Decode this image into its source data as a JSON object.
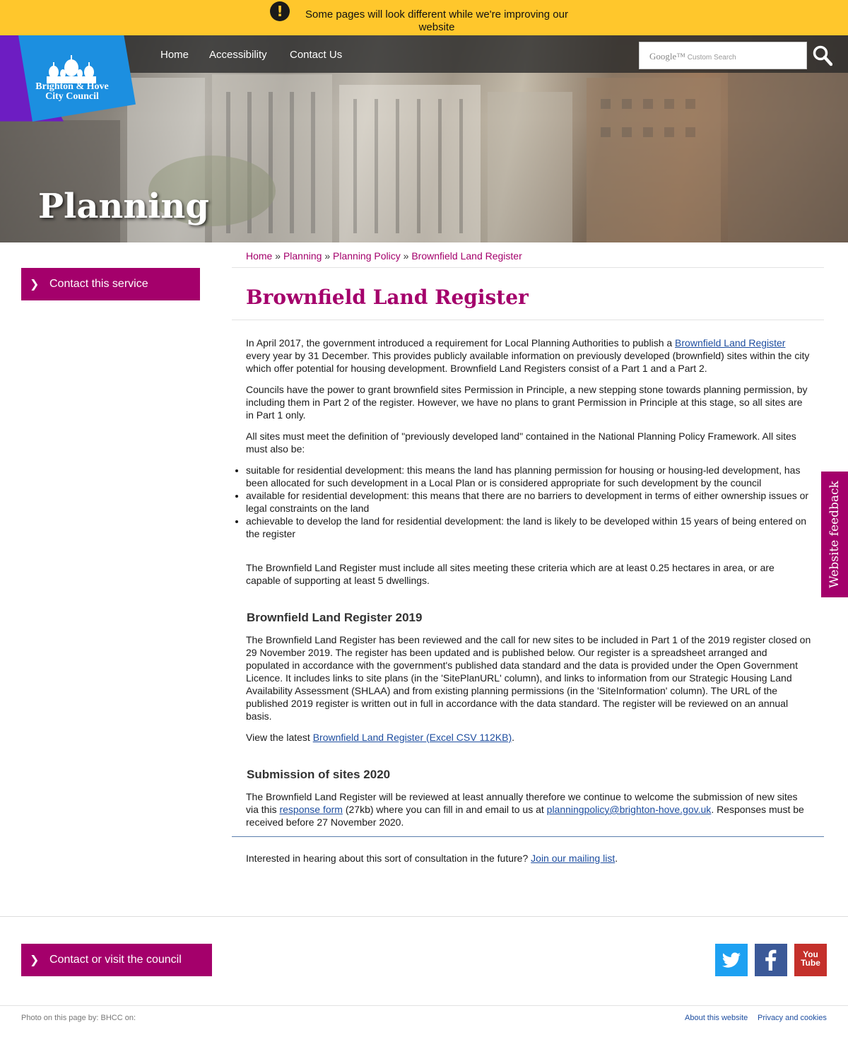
{
  "alert": {
    "icon": "exclamation-icon",
    "text": "Some pages will look different while we're improving our website"
  },
  "header": {
    "logo_text": "Brighton & Hove City Council",
    "nav": [
      "Home",
      "Accessibility",
      "Contact Us"
    ],
    "search_placeholder_brand": "Google™",
    "search_placeholder": "Custom Search",
    "hero_title": "Planning"
  },
  "sidebar": {
    "contact_label": "Contact this service"
  },
  "breadcrumb": {
    "items": [
      "Home",
      "Planning",
      "Planning Policy",
      "Brownfield Land Register"
    ],
    "separator": "»"
  },
  "main": {
    "title": "Brownfield Land Register",
    "p1_a": "In April 2017, the government introduced a requirement for Local Planning Authorities to publish a ",
    "p1_link": "Brownfield Land Register",
    "p1_b": " every year by 31 December. This provides publicly available information on previously developed (brownfield) sites within the city which offer potential for housing development. Brownfield Land Registers consist of a Part 1 and a Part 2.",
    "p2": "Councils have the power to grant brownfield sites Permission in Principle, a new stepping stone towards planning permission, by including them in Part 2 of the register. However, we have no plans to grant Permission in Principle at this stage, so all sites are in Part 1 only.",
    "p3": "All sites must meet the definition of \"previously developed land\" contained in the National Planning Policy Framework. All sites must also be:",
    "bullets": [
      "suitable for residential development: this means the land has planning permission for housing or housing-led development, has been allocated for such development in a Local Plan or is considered appropriate for such development by the council",
      "available for residential development: this means that there are no barriers to development in terms of either ownership issues or legal constraints on the land",
      "achievable to develop the land for residential development: the land is likely to be developed within 15 years of being entered on the register"
    ],
    "p4": "The Brownfield Land Register must include all sites meeting these criteria which are at least 0.25 hectares in area, or are capable of supporting at least 5 dwellings.",
    "h2_2019": "Brownfield Land Register 2019",
    "p5": "The Brownfield Land Register has been reviewed and the call for new sites to be included in Part 1 of the 2019 register closed on 29 November 2019. The register has been updated and is published below. Our register is a spreadsheet arranged and populated in accordance with the government's published data standard and the data is provided under the Open Government Licence. It includes links to site plans (in the 'SitePlanURL' column), and links to information from our Strategic Housing Land Availability Assessment (SHLAA) and from existing planning permissions (in the 'SiteInformation' column). The URL of the published 2019 register is written out in full in accordance with the data standard. The register will be reviewed on an annual basis.",
    "p6_a": "View the latest ",
    "p6_link": "Brownfield Land Register (Excel CSV 112KB)",
    "p6_b": ".",
    "h2_2020": "Submission of sites 2020",
    "p7_a": "The Brownfield Land Register will be reviewed at least annually therefore we continue to welcome the submission of new sites via this ",
    "p7_link1": "response form",
    "p7_b": " (27kb) where you can fill in and email to us at ",
    "p7_link2": "planningpolicy@brighton-hove.gov.uk",
    "p7_c": ". Responses must be received before 27 November 2020.",
    "p8_a": "Interested in hearing about this sort of consultation in the future? ",
    "p8_link": "Join our mailing list",
    "p8_b": "."
  },
  "feedback": {
    "label": "Website feedback"
  },
  "footer": {
    "contact_label": "Contact or visit the council",
    "social": [
      "twitter-icon",
      "facebook-icon",
      "youtube-icon"
    ],
    "youtube_text": "You Tube",
    "photo_credit": "Photo on this page by: BHCC on:",
    "links": [
      "About this website",
      "Privacy and cookies"
    ]
  },
  "colors": {
    "brand": "#a4006b",
    "alert": "#ffc72c",
    "link": "#1d4d9f",
    "twitter": "#1da1f2",
    "facebook": "#3b5998",
    "youtube": "#c4302b"
  }
}
